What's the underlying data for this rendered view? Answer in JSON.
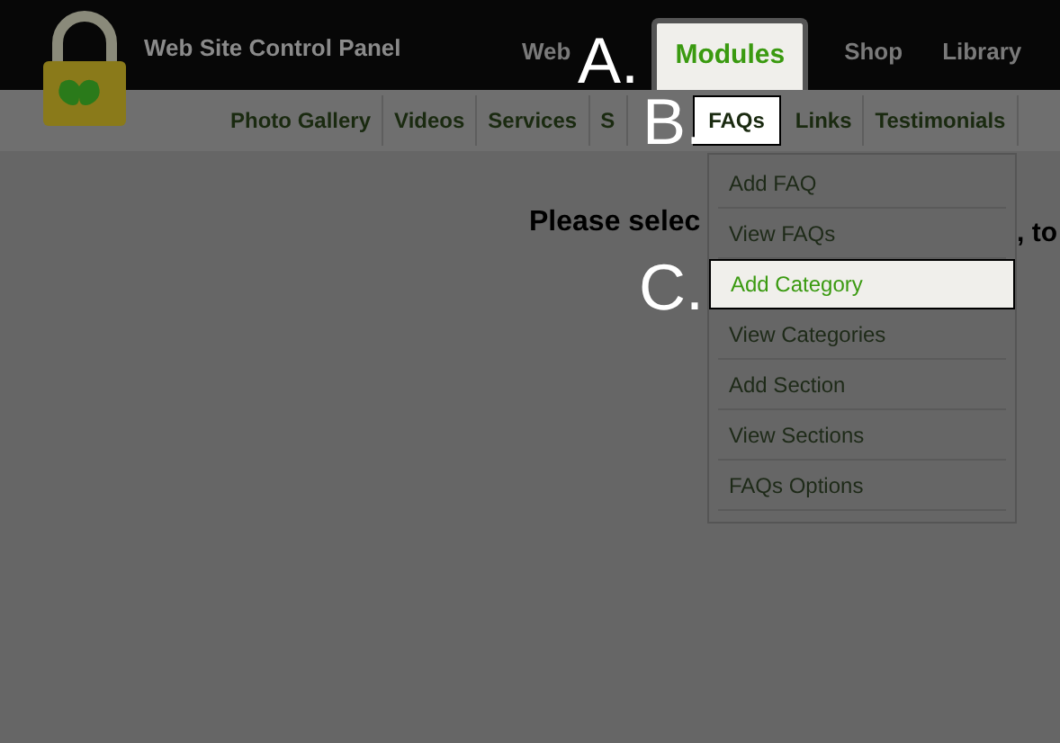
{
  "header": {
    "title": "Web Site Control Panel",
    "tabs": [
      {
        "label": "Web",
        "selected": false
      },
      {
        "label": "Modules",
        "selected": true
      },
      {
        "label": "Shop",
        "selected": false
      },
      {
        "label": "Library",
        "selected": false
      }
    ]
  },
  "subnav": [
    {
      "label": "Photo Gallery",
      "selected": false
    },
    {
      "label": "Videos",
      "selected": false
    },
    {
      "label": "Services",
      "selected": false
    },
    {
      "label": "S",
      "selected": false
    },
    {
      "label": "FAQs",
      "selected": true
    },
    {
      "label": "Links",
      "selected": false
    },
    {
      "label": "Testimonials",
      "selected": false
    }
  ],
  "heading_left": "Please selec",
  "heading_right": ", to",
  "dropdown": [
    {
      "label": "Add FAQ",
      "selected": false
    },
    {
      "label": "View FAQs",
      "selected": false
    },
    {
      "label": "Add Category",
      "selected": true
    },
    {
      "label": "View Categories",
      "selected": false
    },
    {
      "label": "Add Section",
      "selected": false
    },
    {
      "label": "View Sections",
      "selected": false
    },
    {
      "label": "FAQs Options",
      "selected": false
    }
  ],
  "annotations": [
    "A.",
    "B.",
    "C."
  ]
}
